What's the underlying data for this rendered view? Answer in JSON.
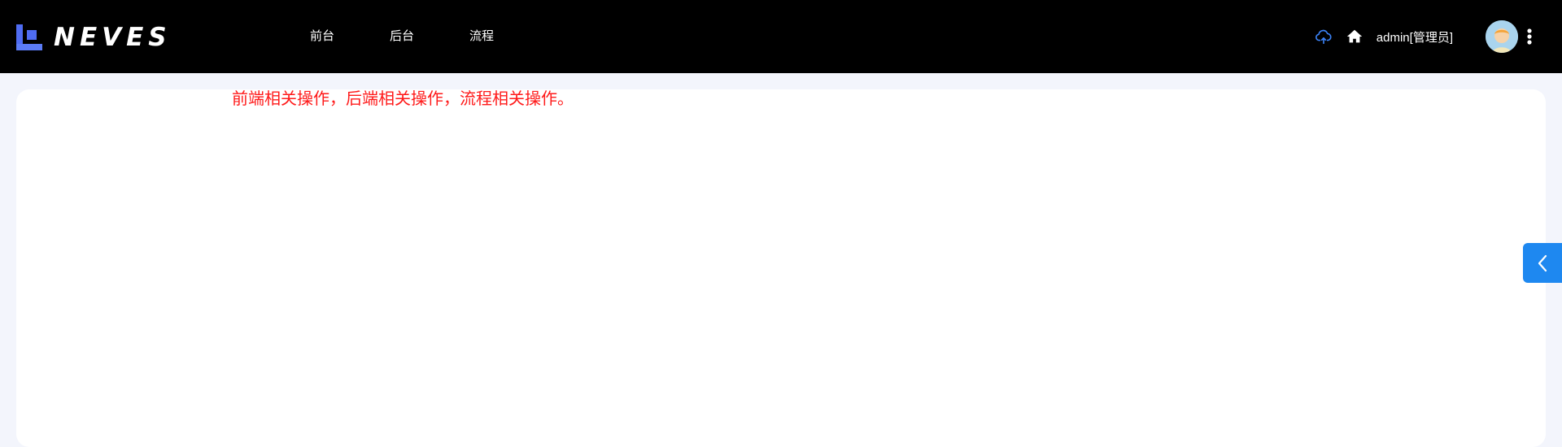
{
  "brand": {
    "name": "NEVES"
  },
  "nav": {
    "items": [
      {
        "label": "前台"
      },
      {
        "label": "后台"
      },
      {
        "label": "流程"
      }
    ]
  },
  "header": {
    "user_label": "admin[管理员]",
    "icons": [
      "cloud-upload-icon",
      "home-icon",
      "avatar",
      "more-vertical-icon"
    ]
  },
  "main": {
    "notice": "前端相关操作，后端相关操作，流程相关操作。"
  },
  "colors": {
    "topbar": "#000000",
    "page_bg": "#f3f5fc",
    "notice_text": "#ff1a1a",
    "accent": "#1e88f0",
    "logo_blue": "#4f6cf2"
  }
}
